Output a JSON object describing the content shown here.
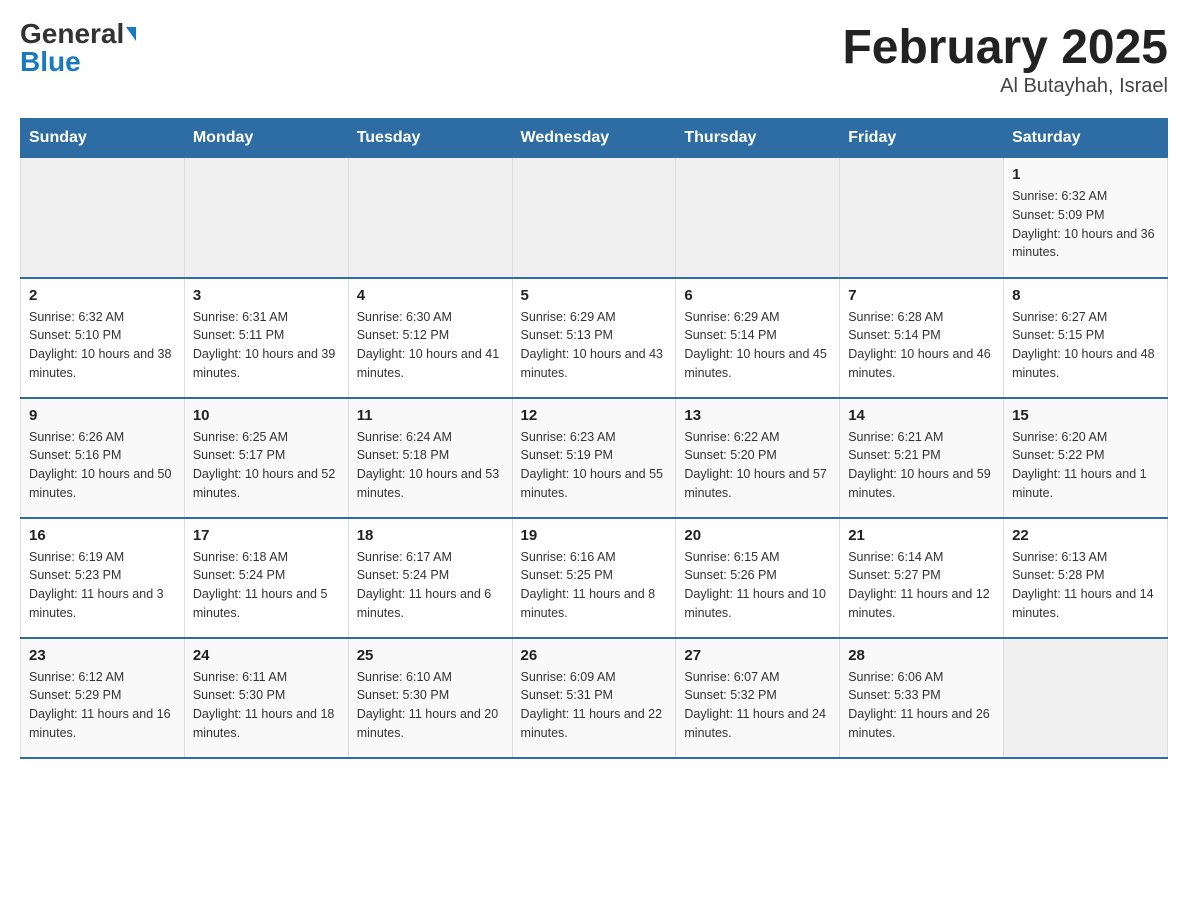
{
  "header": {
    "logo_general": "General",
    "logo_blue": "Blue",
    "month_title": "February 2025",
    "location": "Al Butayhah, Israel"
  },
  "days_of_week": [
    "Sunday",
    "Monday",
    "Tuesday",
    "Wednesday",
    "Thursday",
    "Friday",
    "Saturday"
  ],
  "weeks": [
    [
      {
        "day": "",
        "info": ""
      },
      {
        "day": "",
        "info": ""
      },
      {
        "day": "",
        "info": ""
      },
      {
        "day": "",
        "info": ""
      },
      {
        "day": "",
        "info": ""
      },
      {
        "day": "",
        "info": ""
      },
      {
        "day": "1",
        "info": "Sunrise: 6:32 AM\nSunset: 5:09 PM\nDaylight: 10 hours and 36 minutes."
      }
    ],
    [
      {
        "day": "2",
        "info": "Sunrise: 6:32 AM\nSunset: 5:10 PM\nDaylight: 10 hours and 38 minutes."
      },
      {
        "day": "3",
        "info": "Sunrise: 6:31 AM\nSunset: 5:11 PM\nDaylight: 10 hours and 39 minutes."
      },
      {
        "day": "4",
        "info": "Sunrise: 6:30 AM\nSunset: 5:12 PM\nDaylight: 10 hours and 41 minutes."
      },
      {
        "day": "5",
        "info": "Sunrise: 6:29 AM\nSunset: 5:13 PM\nDaylight: 10 hours and 43 minutes."
      },
      {
        "day": "6",
        "info": "Sunrise: 6:29 AM\nSunset: 5:14 PM\nDaylight: 10 hours and 45 minutes."
      },
      {
        "day": "7",
        "info": "Sunrise: 6:28 AM\nSunset: 5:14 PM\nDaylight: 10 hours and 46 minutes."
      },
      {
        "day": "8",
        "info": "Sunrise: 6:27 AM\nSunset: 5:15 PM\nDaylight: 10 hours and 48 minutes."
      }
    ],
    [
      {
        "day": "9",
        "info": "Sunrise: 6:26 AM\nSunset: 5:16 PM\nDaylight: 10 hours and 50 minutes."
      },
      {
        "day": "10",
        "info": "Sunrise: 6:25 AM\nSunset: 5:17 PM\nDaylight: 10 hours and 52 minutes."
      },
      {
        "day": "11",
        "info": "Sunrise: 6:24 AM\nSunset: 5:18 PM\nDaylight: 10 hours and 53 minutes."
      },
      {
        "day": "12",
        "info": "Sunrise: 6:23 AM\nSunset: 5:19 PM\nDaylight: 10 hours and 55 minutes."
      },
      {
        "day": "13",
        "info": "Sunrise: 6:22 AM\nSunset: 5:20 PM\nDaylight: 10 hours and 57 minutes."
      },
      {
        "day": "14",
        "info": "Sunrise: 6:21 AM\nSunset: 5:21 PM\nDaylight: 10 hours and 59 minutes."
      },
      {
        "day": "15",
        "info": "Sunrise: 6:20 AM\nSunset: 5:22 PM\nDaylight: 11 hours and 1 minute."
      }
    ],
    [
      {
        "day": "16",
        "info": "Sunrise: 6:19 AM\nSunset: 5:23 PM\nDaylight: 11 hours and 3 minutes."
      },
      {
        "day": "17",
        "info": "Sunrise: 6:18 AM\nSunset: 5:24 PM\nDaylight: 11 hours and 5 minutes."
      },
      {
        "day": "18",
        "info": "Sunrise: 6:17 AM\nSunset: 5:24 PM\nDaylight: 11 hours and 6 minutes."
      },
      {
        "day": "19",
        "info": "Sunrise: 6:16 AM\nSunset: 5:25 PM\nDaylight: 11 hours and 8 minutes."
      },
      {
        "day": "20",
        "info": "Sunrise: 6:15 AM\nSunset: 5:26 PM\nDaylight: 11 hours and 10 minutes."
      },
      {
        "day": "21",
        "info": "Sunrise: 6:14 AM\nSunset: 5:27 PM\nDaylight: 11 hours and 12 minutes."
      },
      {
        "day": "22",
        "info": "Sunrise: 6:13 AM\nSunset: 5:28 PM\nDaylight: 11 hours and 14 minutes."
      }
    ],
    [
      {
        "day": "23",
        "info": "Sunrise: 6:12 AM\nSunset: 5:29 PM\nDaylight: 11 hours and 16 minutes."
      },
      {
        "day": "24",
        "info": "Sunrise: 6:11 AM\nSunset: 5:30 PM\nDaylight: 11 hours and 18 minutes."
      },
      {
        "day": "25",
        "info": "Sunrise: 6:10 AM\nSunset: 5:30 PM\nDaylight: 11 hours and 20 minutes."
      },
      {
        "day": "26",
        "info": "Sunrise: 6:09 AM\nSunset: 5:31 PM\nDaylight: 11 hours and 22 minutes."
      },
      {
        "day": "27",
        "info": "Sunrise: 6:07 AM\nSunset: 5:32 PM\nDaylight: 11 hours and 24 minutes."
      },
      {
        "day": "28",
        "info": "Sunrise: 6:06 AM\nSunset: 5:33 PM\nDaylight: 11 hours and 26 minutes."
      },
      {
        "day": "",
        "info": ""
      }
    ]
  ]
}
